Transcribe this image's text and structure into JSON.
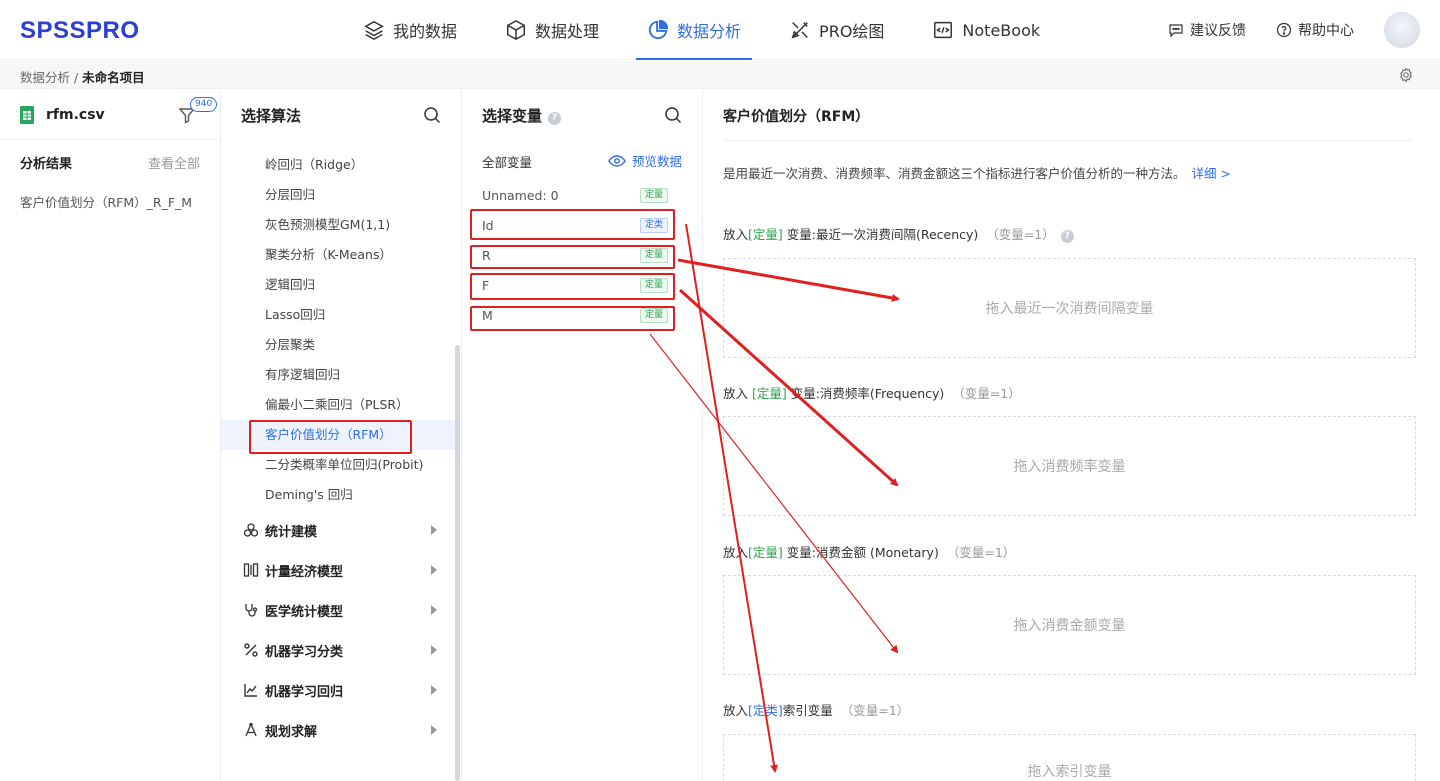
{
  "app": {
    "logo": "SPSSPRO"
  },
  "nav": [
    {
      "label": "我的数据",
      "icon": "layers-icon",
      "active": false
    },
    {
      "label": "数据处理",
      "icon": "cube-icon",
      "active": false
    },
    {
      "label": "数据分析",
      "icon": "pie-chart-icon",
      "active": true
    },
    {
      "label": "PRO绘图",
      "icon": "draw-tools-icon",
      "active": false
    },
    {
      "label": "NoteBook",
      "icon": "code-icon",
      "active": false
    }
  ],
  "topRight": {
    "feedback": "建议反馈",
    "help": "帮助中心"
  },
  "breadcrumb": {
    "parent": "数据分析 /",
    "current": "未命名项目"
  },
  "file": {
    "name": "rfm.csv",
    "rows": "940"
  },
  "results": {
    "title": "分析结果",
    "viewAll": "查看全部",
    "items": [
      "客户价值划分（RFM）_R_F_M"
    ]
  },
  "algorithms": {
    "title": "选择算法",
    "items": [
      "岭回归（Ridge）",
      "分层回归",
      "灰色预测模型GM(1,1)",
      "聚类分析（K-Means）",
      "逻辑回归",
      "Lasso回归",
      "分层聚类",
      "有序逻辑回归",
      "偏最小二乘回归（PLSR）",
      "客户价值划分（RFM）",
      "二分类概率单位回归(Probit)",
      "Deming's 回归"
    ],
    "selected": "客户价值划分（RFM）",
    "categories": [
      "统计建模",
      "计量经济模型",
      "医学统计模型",
      "机器学习分类",
      "机器学习回归",
      "规划求解"
    ]
  },
  "variables": {
    "title": "选择变量",
    "help": "?",
    "allLabel": "全部变量",
    "preview": "预览数据",
    "items": [
      {
        "name": "Unnamed: 0",
        "tag": "定量"
      },
      {
        "name": "Id",
        "tag": "定类"
      },
      {
        "name": "R",
        "tag": "定量"
      },
      {
        "name": "F",
        "tag": "定量"
      },
      {
        "name": "M",
        "tag": "定量"
      }
    ]
  },
  "panel": {
    "title": "客户价值划分（RFM）",
    "description": "是用最近一次消费、消费频率、消费金额这三个指标进行客户价值分析的一种方法。",
    "more": "详细 >",
    "slots": [
      {
        "prefix": "放入",
        "tag": "[定量]",
        "text": " 变量:最近一次消费间隔(Recency)",
        "limit": "（变量=1）",
        "help": "?",
        "placeholder": "拖入最近一次消费间隔变量"
      },
      {
        "prefix": "放入 ",
        "tag": "[定量]",
        "text": " 变量:消费频率(Frequency)",
        "limit": "（变量=1）",
        "help": "",
        "placeholder": "拖入消费频率变量"
      },
      {
        "prefix": "放入",
        "tag": "[定量]",
        "text": " 变量:消费金额 (Monetary)",
        "limit": "（变量=1）",
        "help": "",
        "placeholder": "拖入消费金额变量"
      },
      {
        "prefix": "放入",
        "tag": "[定类]",
        "text": "索引变量",
        "limit": "（变量=1）",
        "help": "",
        "placeholder": "拖入索引变量"
      }
    ]
  },
  "colors": {
    "accent": "#2f6fe3",
    "logo": "#2b3fd1",
    "quant": "#2ea24f",
    "annotation": "#e02020"
  }
}
